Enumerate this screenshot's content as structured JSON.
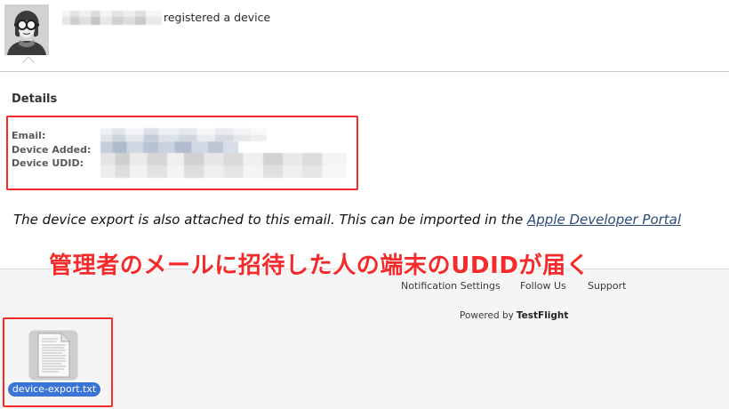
{
  "header": {
    "action_text": "registered a device"
  },
  "details": {
    "heading": "Details",
    "fields": [
      {
        "label": "Email:"
      },
      {
        "label": "Device Added:"
      },
      {
        "label": "Device UDID:"
      }
    ]
  },
  "message": {
    "export_note": "The device export is also attached to this email. This can be imported in the ",
    "portal_link": "Apple Developer Portal"
  },
  "annotation": {
    "text": "管理者のメールに招待した人の端末のUDIDが届く"
  },
  "footer": {
    "links": [
      "Notification Settings",
      "Follow Us",
      "Support"
    ],
    "powered_by": "Powered by",
    "brand": "TestFlight"
  },
  "attachment": {
    "filename": "device-export.txt"
  },
  "icons": {
    "avatar": "aviator-avatar",
    "attachment": "text-file-icon"
  },
  "colors": {
    "highlight_red": "#f52b2b",
    "link": "#2b4a7a",
    "selection_blue": "#3a74d6"
  }
}
